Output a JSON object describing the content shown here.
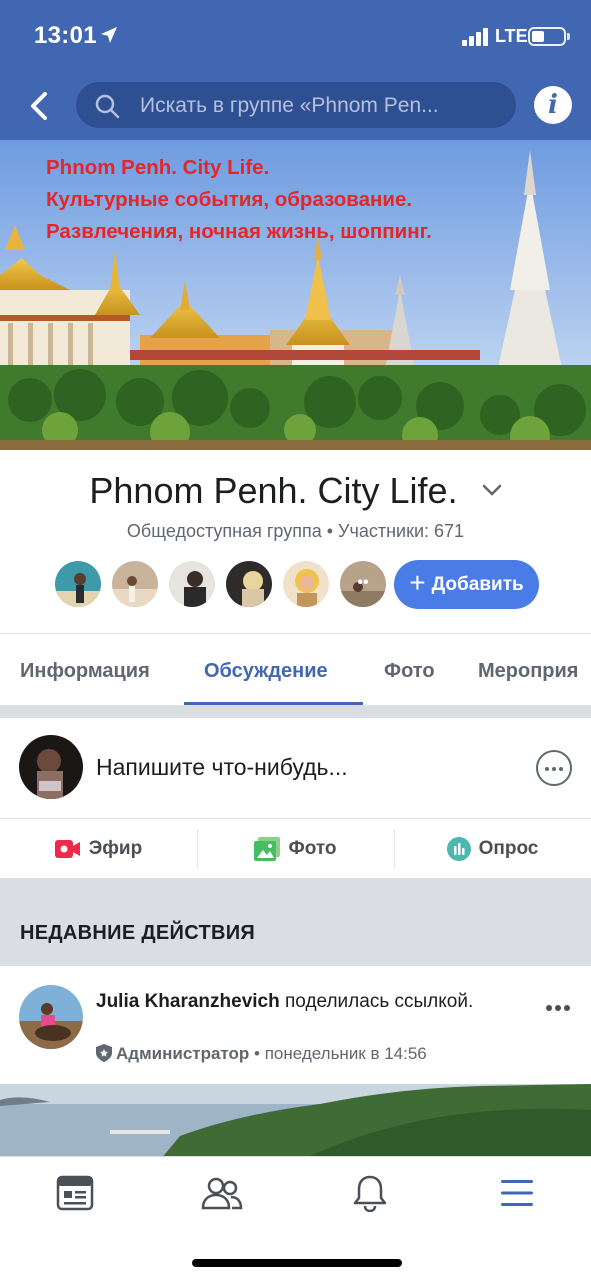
{
  "status_bar": {
    "time": "13:01",
    "network": "LTE"
  },
  "search": {
    "placeholder": "Искать в группе «Phnom Pen..."
  },
  "cover": {
    "lines": [
      "Phnom Penh. City Life.",
      "Культурные события, образование.",
      "Развлечения, ночная жизнь, шоппинг."
    ],
    "text_color": "#e4262c"
  },
  "group": {
    "name": "Phnom Penh. City Life.",
    "meta": "Общедоступная группа • Участники: 671",
    "add_label": "Добавить",
    "more_members": "••"
  },
  "tabs": [
    {
      "label": "Информация"
    },
    {
      "label": "Обсуждение",
      "active": true
    },
    {
      "label": "Фото"
    },
    {
      "label": "Мероприя"
    }
  ],
  "composer": {
    "prompt": "Напишите что-нибудь..."
  },
  "composer_actions": [
    {
      "label": "Эфир",
      "icon": "live-video-icon",
      "color": "#f02849"
    },
    {
      "label": "Фото",
      "icon": "photo-icon",
      "color": "#45bd62"
    },
    {
      "label": "Опрос",
      "icon": "poll-icon",
      "color": "#4cb8b0"
    }
  ],
  "section": {
    "recent_label": "НЕДАВНИЕ ДЕЙСТВИЯ"
  },
  "post": {
    "author": "Julia Kharanzhevich",
    "action": " поделилась ссылкой.",
    "role": "Администратор",
    "time": " • понедельник в 14:56"
  },
  "bottom_nav": [
    {
      "icon": "news-feed-icon",
      "active": false
    },
    {
      "icon": "groups-icon",
      "active": false
    },
    {
      "icon": "notifications-bell-icon",
      "active": false
    },
    {
      "icon": "menu-icon",
      "active": true
    }
  ],
  "colors": {
    "brand": "#4267b2",
    "accent_button": "#4a7ce8",
    "secondary_text": "#606770"
  }
}
